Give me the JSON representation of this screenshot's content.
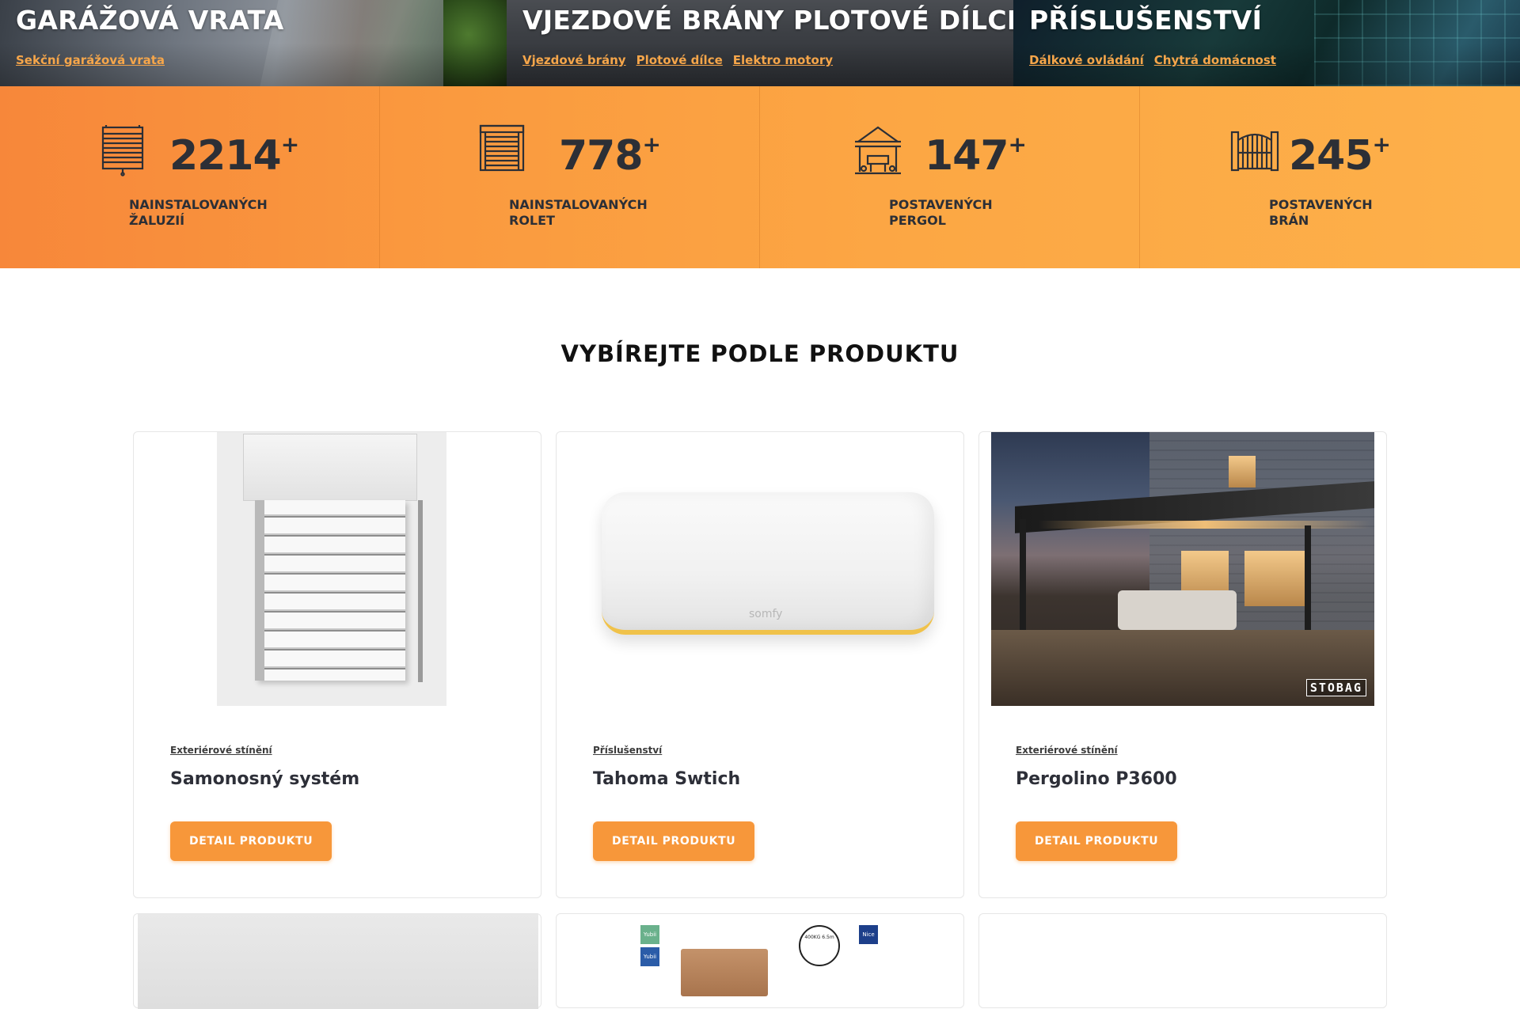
{
  "hero": {
    "panels": [
      {
        "title": "GARÁŽOVÁ VRATA",
        "links": [
          "Sekční garážová vrata"
        ]
      },
      {
        "title": "VJEZDOVÉ BRÁNY PLOTOVÉ DÍLCE",
        "links": [
          "Vjezdové brány",
          "Plotové dílce",
          "Elektro motory"
        ]
      },
      {
        "title": "PŘÍSLUŠENSTVÍ",
        "links": [
          "Dálkové ovládání",
          "Chytrá domácnost"
        ]
      }
    ]
  },
  "stats": [
    {
      "icon": "blinds-icon",
      "number": "2214",
      "suffix": "+",
      "label_line1": "NAINSTALOVANÝCH",
      "label_line2": "ŽALUZIÍ"
    },
    {
      "icon": "roller-shutter-icon",
      "number": "778",
      "suffix": "+",
      "label_line1": "NAINSTALOVANÝCH",
      "label_line2": "ROLET"
    },
    {
      "icon": "pergola-icon",
      "number": "147",
      "suffix": "+",
      "label_line1": "POSTAVENÝCH",
      "label_line2": "PERGOL"
    },
    {
      "icon": "gate-icon",
      "number": "245",
      "suffix": "+",
      "label_line1": "POSTAVENÝCH",
      "label_line2": "BRÁN"
    }
  ],
  "section": {
    "title": "VYBÍREJTE PODLE PRODUKTU"
  },
  "products": [
    {
      "category": "Exteriérové stínění",
      "title": "Samonosný systém",
      "button": "DETAIL PRODUKTU",
      "image": "exterior-blind-image"
    },
    {
      "category": "Příslušenství",
      "title": "Tahoma Swtich",
      "button": "DETAIL PRODUKTU",
      "image": "somfy-hub-image",
      "image_logo": "somfy"
    },
    {
      "category": "Exteriérové stínění",
      "title": "Pergolino P3600",
      "button": "DETAIL PRODUKTU",
      "image": "pergola-image",
      "image_logo": "STOBAG"
    }
  ],
  "products_row2": {
    "card2_logos": [
      "Yubii",
      "Yubii",
      "Nice"
    ],
    "card2_circle_text": "400KG 6.5m"
  },
  "colors": {
    "accent": "#f7973a",
    "stats_band_start": "#f7873a",
    "stats_band_end": "#fdb04a",
    "link": "#f6a64a",
    "text_dark": "#2c2f36"
  }
}
